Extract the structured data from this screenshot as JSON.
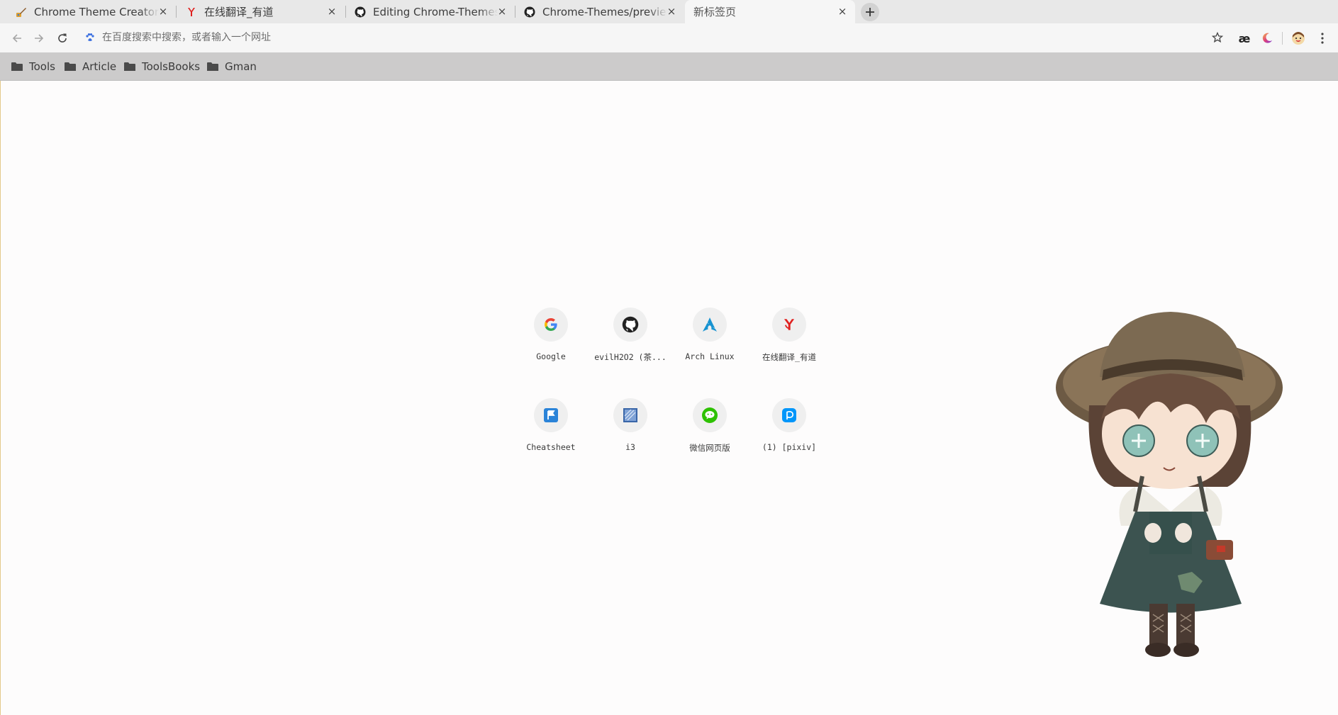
{
  "tabs": [
    {
      "title": "Chrome Theme Creator - Ch",
      "favicon": "paintbrush-icon",
      "close": "×"
    },
    {
      "title": "在线翻译_有道",
      "favicon": "youdao-icon",
      "close": "×"
    },
    {
      "title": "Editing Chrome-Themes/RE",
      "favicon": "github-icon",
      "close": "×"
    },
    {
      "title": "Chrome-Themes/preview.p",
      "favicon": "github-icon",
      "close": "×"
    },
    {
      "title": "新标签页",
      "favicon": "",
      "close": "×"
    }
  ],
  "new_tab_icon": "plus-icon",
  "toolbar": {
    "back_icon": "back-arrow-icon",
    "forward_icon": "forward-arrow-icon",
    "reload_icon": "reload-icon",
    "search_engine_icon": "baidu-paw-icon",
    "omnibox_placeholder": "在百度搜索中搜索，或者输入一个网址",
    "bookmark_star_icon": "star-icon",
    "extensions": [
      {
        "name": "ae-extension",
        "label": "æ"
      },
      {
        "name": "dark-mode-moon-icon",
        "label": ""
      },
      {
        "name": "profile-avatar",
        "label": ""
      }
    ],
    "menu_icon": "kebab-menu-icon"
  },
  "bookmarks": [
    {
      "label": "Tools",
      "icon": "folder-icon"
    },
    {
      "label": "Article",
      "icon": "folder-icon"
    },
    {
      "label": "ToolsBooks",
      "icon": "folder-icon"
    },
    {
      "label": "Gman",
      "icon": "folder-icon"
    }
  ],
  "shortcuts": [
    {
      "label": "Google",
      "icon": "google-icon"
    },
    {
      "label": "evilH2O2 (茶...",
      "icon": "github-icon"
    },
    {
      "label": "Arch Linux",
      "icon": "arch-linux-icon"
    },
    {
      "label": "在线翻译_有道",
      "icon": "youdao-icon"
    },
    {
      "label": "Cheatsheet",
      "icon": "cheatsheet-icon"
    },
    {
      "label": "i3",
      "icon": "i3-icon"
    },
    {
      "label": "微信网页版",
      "icon": "wechat-icon"
    },
    {
      "label": "(1) [pixiv]",
      "icon": "pixiv-icon"
    }
  ],
  "colors": {
    "tabstrip": "#e8e8e8",
    "toolbar": "#f6f6f6",
    "bookmarks_bar": "#cccbcb",
    "page_bg": "#fdfcfc"
  }
}
